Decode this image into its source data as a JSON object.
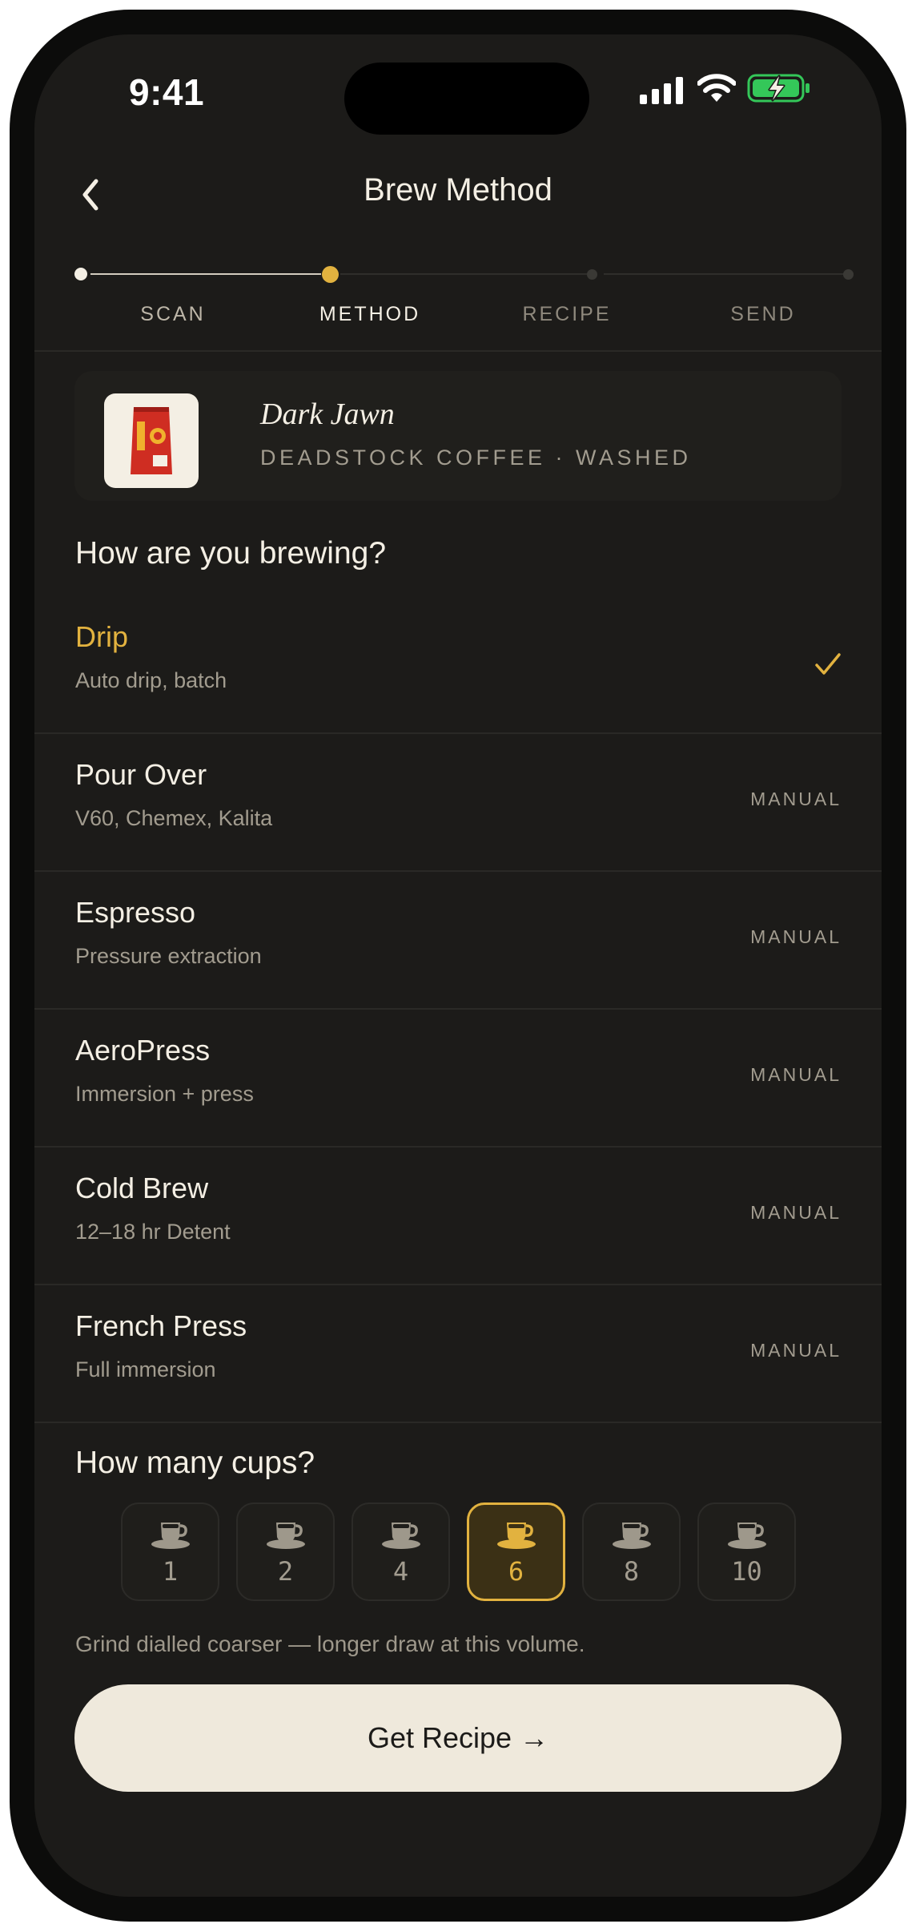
{
  "status_bar": {
    "time": "9:41"
  },
  "nav": {
    "title": "Brew Method",
    "back_icon": "chevron-left-icon"
  },
  "steps": [
    {
      "label": "SCAN",
      "state": "done"
    },
    {
      "label": "METHOD",
      "state": "current"
    },
    {
      "label": "RECIPE",
      "state": "upcoming"
    },
    {
      "label": "SEND",
      "state": "upcoming"
    }
  ],
  "coffee": {
    "name": "Dark Jawn",
    "meta": "DEADSTOCK COFFEE · WASHED",
    "thumbnail_icon": "coffee-bag-icon"
  },
  "brewing_question": "How are you brewing?",
  "methods": [
    {
      "name": "Drip",
      "sub": "Auto drip, batch",
      "tag": "",
      "selected": true
    },
    {
      "name": "Pour Over",
      "sub": "V60, Chemex, Kalita",
      "tag": "MANUAL",
      "selected": false
    },
    {
      "name": "Espresso",
      "sub": "Pressure extraction",
      "tag": "MANUAL",
      "selected": false
    },
    {
      "name": "AeroPress",
      "sub": "Immersion + press",
      "tag": "MANUAL",
      "selected": false
    },
    {
      "name": "Cold Brew",
      "sub": "12–18 hr Detent",
      "tag": "MANUAL",
      "selected": false
    },
    {
      "name": "French Press",
      "sub": "Full immersion",
      "tag": "MANUAL",
      "selected": false
    }
  ],
  "cups_question": "How many cups?",
  "cup_options": [
    {
      "value": "1",
      "selected": false
    },
    {
      "value": "2",
      "selected": false
    },
    {
      "value": "4",
      "selected": false
    },
    {
      "value": "6",
      "selected": true
    },
    {
      "value": "8",
      "selected": false
    },
    {
      "value": "10",
      "selected": false
    }
  ],
  "hint": "Grind dialled coarser — longer draw at this volume.",
  "cta": {
    "label": "Get Recipe →"
  },
  "colors": {
    "background": "#1c1b19",
    "accent": "#e2b23f",
    "text": "#f4efe4",
    "muted": "#a29c8f",
    "cta_bg": "#efe9dc",
    "battery": "#34c759"
  }
}
